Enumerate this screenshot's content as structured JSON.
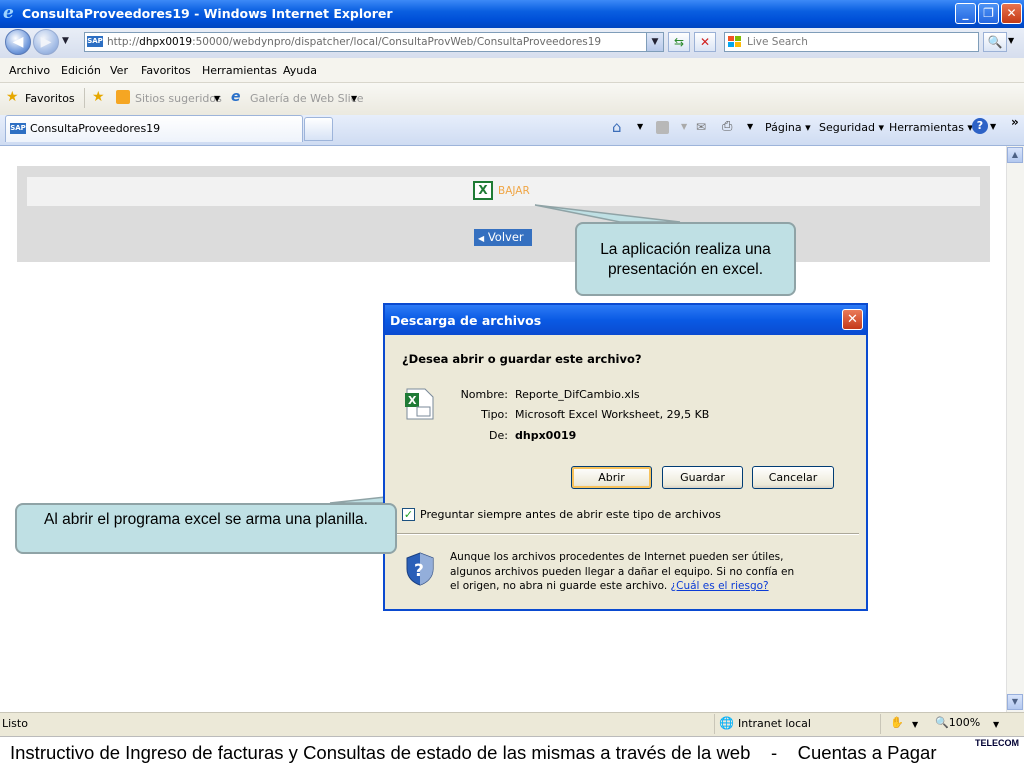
{
  "window": {
    "title": "ConsultaProveedores19 - Windows Internet Explorer"
  },
  "address_bar": {
    "url_prefix": "http://",
    "url_host": "dhpx0019",
    "url_rest": ":50000/webdynpro/dispatcher/local/ConsultaProvWeb/ConsultaProveedores19",
    "search_placeholder": "Live Search"
  },
  "menu": [
    "Archivo",
    "Edición",
    "Ver",
    "Favoritos",
    "Herramientas",
    "Ayuda"
  ],
  "favorites_bar": {
    "favorites_label": "Favoritos",
    "suggested_sites": "Sitios sugeridos",
    "web_slice_gallery": "Galería de Web Slice"
  },
  "tabs": {
    "active_tab": "ConsultaProveedores19"
  },
  "command_bar": {
    "page": "Página",
    "security": "Seguridad",
    "tools": "Herramientas"
  },
  "page": {
    "bajar_label": "BAJAR",
    "volver_label": "Volver"
  },
  "callouts": {
    "top": "La aplicación realiza una presentación en excel.",
    "left": "Al abrir el programa excel se arma una planilla."
  },
  "dialog": {
    "title": "Descarga de archivos",
    "question": "¿Desea abrir o guardar este archivo?",
    "name_label": "Nombre:",
    "name_value": "Reporte_DifCambio.xls",
    "type_label": "Tipo:",
    "type_value": "Microsoft Excel Worksheet, 29,5 KB",
    "from_label": "De:",
    "from_value": "dhpx0019",
    "open_button": "Abrir",
    "save_button": "Guardar",
    "cancel_button": "Cancelar",
    "always_ask_label": "Preguntar siempre antes de abrir este tipo de archivos",
    "always_ask_checked": true,
    "warning_line1": "Aunque los archivos procedentes de Internet pueden ser útiles,",
    "warning_line2": "algunos archivos pueden llegar a dañar el equipo. Si no confía en",
    "warning_line3": "el origen, no abra ni guarde este archivo.",
    "risk_link": "¿Cuál es el riesgo?"
  },
  "status_bar": {
    "status": "Listo",
    "zone": "Intranet local",
    "zoom": "100%"
  },
  "footer": {
    "text": "Instructivo de Ingreso de facturas y Consultas de estado de las mismas a través de la web    -    Cuentas a Pagar",
    "brand": "TELECOM"
  },
  "colors": {
    "titlebar_blue": "#0050d8",
    "callout_fill": "#bfe0e4",
    "bajar_orange": "#f0a646",
    "volver_blue": "#3570c0"
  }
}
